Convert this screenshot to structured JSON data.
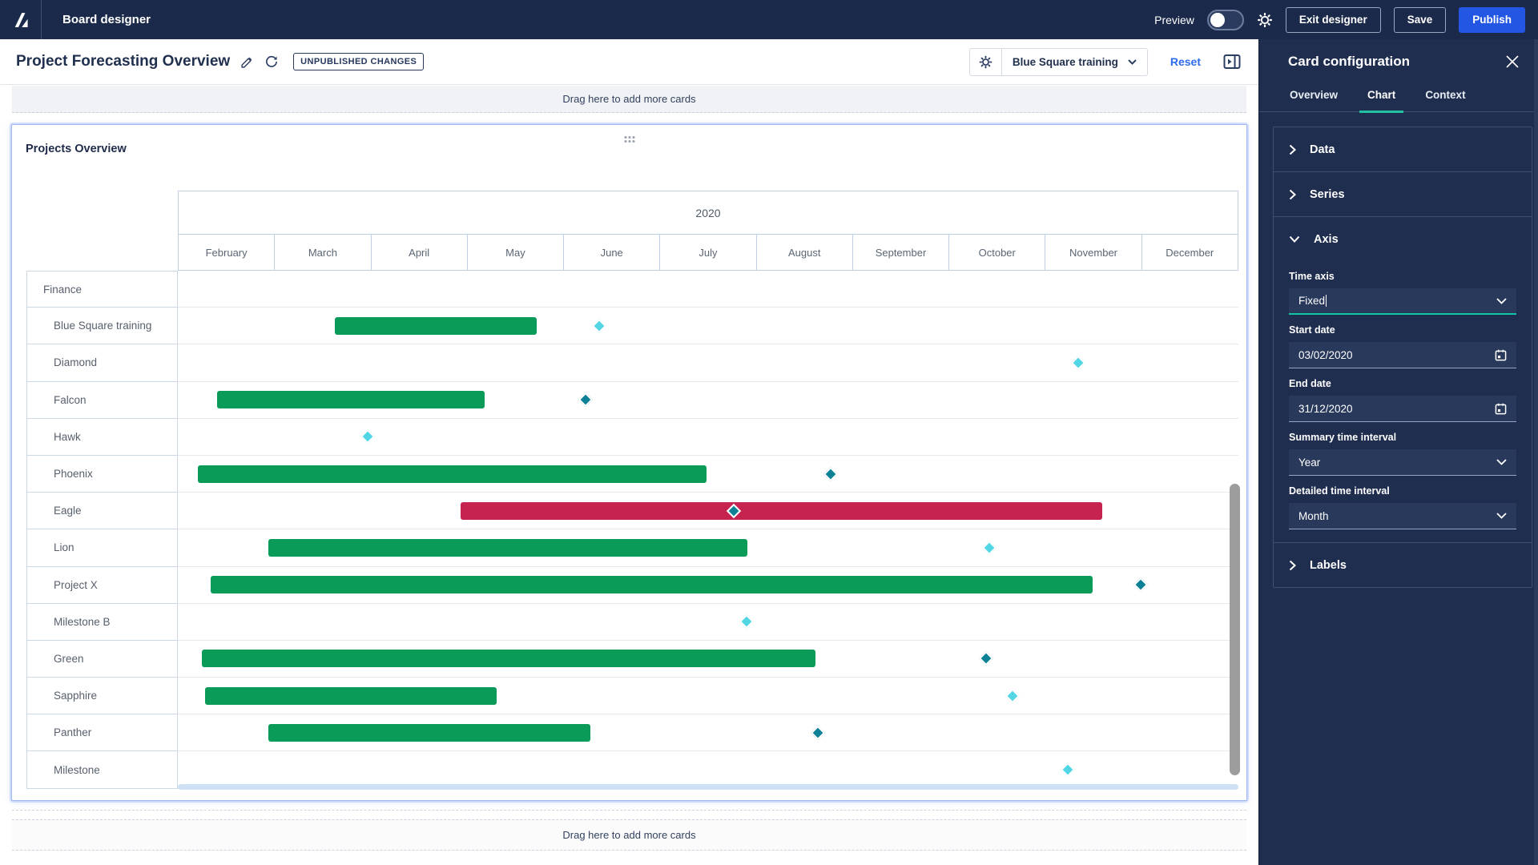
{
  "topbar": {
    "app_title": "Board designer",
    "preview_label": "Preview",
    "exit_button": "Exit designer",
    "save_button": "Save",
    "publish_button": "Publish"
  },
  "toolbar": {
    "page_title": "Project Forecasting Overview",
    "badge": "UNPUBLISHED CHANGES",
    "context_selector_value": "Blue Square training",
    "reset_label": "Reset"
  },
  "board": {
    "top_dropzone": "Drag here to add more cards",
    "bottom_dropzone": "Drag here to add more cards"
  },
  "card": {
    "title": "Projects Overview"
  },
  "panel": {
    "title": "Card configuration",
    "tabs": [
      {
        "label": "Overview",
        "active": false
      },
      {
        "label": "Chart",
        "active": true
      },
      {
        "label": "Context",
        "active": false
      }
    ],
    "sections": {
      "data_label": "Data",
      "series_label": "Series",
      "axis_label": "Axis",
      "labels_label": "Labels",
      "time_axis_label": "Time axis",
      "time_axis_value": "Fixed",
      "start_date_label": "Start date",
      "start_date_value": "03/02/2020",
      "end_date_label": "End date",
      "end_date_value": "31/12/2020",
      "summary_label": "Summary time interval",
      "summary_value": "Year",
      "detailed_label": "Detailed time interval",
      "detailed_value": "Month"
    }
  },
  "chart_data": {
    "type": "gantt",
    "year_header": "2020",
    "months": [
      "February",
      "March",
      "April",
      "May",
      "June",
      "July",
      "August",
      "September",
      "October",
      "November",
      "December"
    ],
    "colors": {
      "green": "#0a9b58",
      "red": "#c72350",
      "cyan": "#52d5e5",
      "teal": "#0d8195"
    },
    "rows": [
      {
        "label": "Finance",
        "indent": 0
      },
      {
        "label": "Blue Square training",
        "indent": 1,
        "bar": {
          "start": 1.63,
          "end": 3.72,
          "color": "green"
        },
        "milestone": {
          "pos": 4.37,
          "color": "cyan"
        }
      },
      {
        "label": "Diamond",
        "indent": 1,
        "milestone": {
          "pos": 9.34,
          "color": "cyan"
        }
      },
      {
        "label": "Falcon",
        "indent": 1,
        "bar": {
          "start": 0.41,
          "end": 3.18,
          "color": "green"
        },
        "milestone": {
          "pos": 4.23,
          "color": "teal"
        }
      },
      {
        "label": "Hawk",
        "indent": 1,
        "milestone": {
          "pos": 1.97,
          "color": "cyan"
        }
      },
      {
        "label": "Phoenix",
        "indent": 1,
        "bar": {
          "start": 0.21,
          "end": 5.48,
          "color": "green"
        },
        "milestone": {
          "pos": 6.77,
          "color": "teal"
        }
      },
      {
        "label": "Eagle",
        "indent": 1,
        "bar": {
          "start": 2.93,
          "end": 9.59,
          "color": "red"
        },
        "milestone": {
          "pos": 5.77,
          "color": "teal"
        }
      },
      {
        "label": "Lion",
        "indent": 1,
        "bar": {
          "start": 0.94,
          "end": 5.91,
          "color": "green"
        },
        "milestone": {
          "pos": 8.42,
          "color": "cyan"
        }
      },
      {
        "label": "Project X",
        "indent": 1,
        "bar": {
          "start": 0.34,
          "end": 9.49,
          "color": "green"
        },
        "milestone": {
          "pos": 9.99,
          "color": "teal"
        }
      },
      {
        "label": "Milestone B",
        "indent": 1,
        "milestone": {
          "pos": 5.9,
          "color": "cyan"
        }
      },
      {
        "label": "Green",
        "indent": 1,
        "bar": {
          "start": 0.25,
          "end": 6.61,
          "color": "green"
        },
        "milestone": {
          "pos": 8.38,
          "color": "teal"
        }
      },
      {
        "label": "Sapphire",
        "indent": 1,
        "bar": {
          "start": 0.28,
          "end": 3.31,
          "color": "green"
        },
        "milestone": {
          "pos": 8.66,
          "color": "cyan"
        }
      },
      {
        "label": "Panther",
        "indent": 1,
        "bar": {
          "start": 0.94,
          "end": 4.28,
          "color": "green"
        },
        "milestone": {
          "pos": 6.64,
          "color": "teal"
        }
      },
      {
        "label": "Milestone",
        "indent": 1,
        "milestone": {
          "pos": 9.23,
          "color": "cyan"
        }
      }
    ]
  }
}
